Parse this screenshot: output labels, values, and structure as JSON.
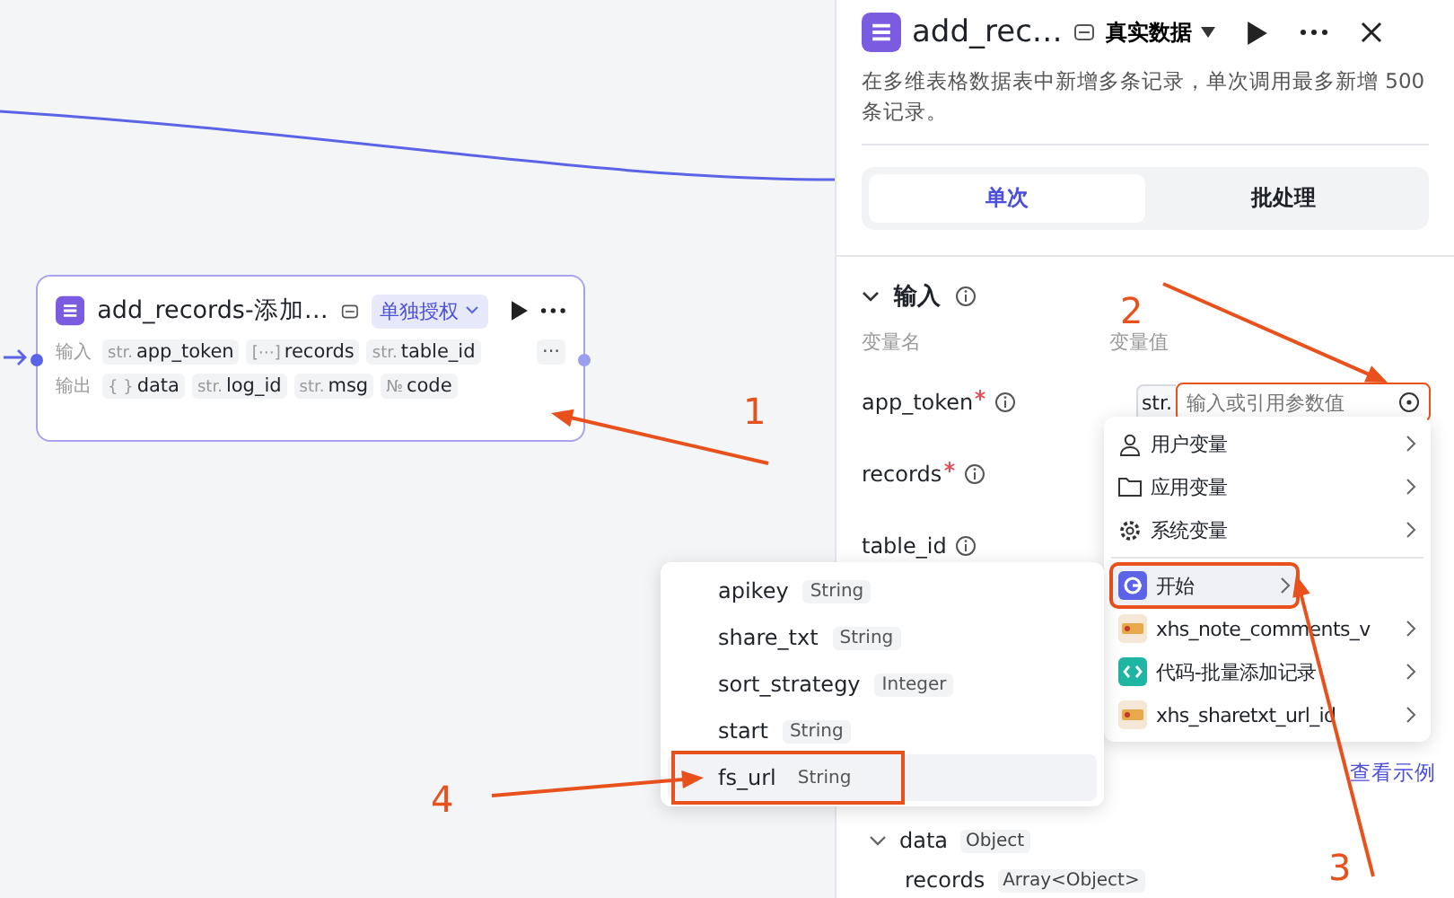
{
  "node": {
    "title": "add_records-添加…",
    "auth": "单独授权",
    "input_label": "输入",
    "inputs": [
      {
        "type": "str.",
        "name": "app_token"
      },
      {
        "type": "[⋯]",
        "name": "records"
      },
      {
        "type": "str.",
        "name": "table_id"
      }
    ],
    "more": "···",
    "output_label": "输出",
    "outputs": [
      {
        "type": "{ }",
        "name": "data"
      },
      {
        "type": "str.",
        "name": "log_id"
      },
      {
        "type": "str.",
        "name": "msg"
      },
      {
        "type": "№",
        "name": "code"
      }
    ]
  },
  "panel": {
    "title": "add_rec…",
    "mode": "真实数据",
    "description": "在多维表格数据表中新增多条记录，单次调用最多新增 500 条记录。",
    "tabs": [
      {
        "label": "单次",
        "selected": true
      },
      {
        "label": "批处理",
        "selected": false
      }
    ],
    "input_section": {
      "title": "输入",
      "expanded": true,
      "name_header": "变量名",
      "value_header": "变量值",
      "params": [
        {
          "name": "app_token",
          "required": true,
          "type": "str.",
          "placeholder": "输入或引用参数值",
          "annotated": true
        },
        {
          "name": "records",
          "required": true
        },
        {
          "name": "table_id",
          "required": false
        }
      ]
    },
    "example_link": "查看示例",
    "output": {
      "name": "data",
      "type": "Object",
      "expanded": true,
      "children": [
        {
          "name": "records",
          "type": "Array<Object>"
        }
      ]
    }
  },
  "reference_menu": [
    {
      "kind": "user",
      "label": "用户变量",
      "selected": false,
      "annotated": false
    },
    {
      "kind": "app",
      "label": "应用变量",
      "selected": false,
      "annotated": false
    },
    {
      "kind": "system",
      "label": "系统变量",
      "selected": false,
      "annotated": false
    },
    {
      "kind": "start",
      "label": "开始",
      "selected": true,
      "annotated": true
    },
    {
      "kind": "plugin",
      "label": "xhs_note_comments_v",
      "selected": false,
      "annotated": false
    },
    {
      "kind": "code",
      "label": "代码-批量添加记录",
      "selected": false,
      "annotated": false
    },
    {
      "kind": "plugin",
      "label": "xhs_sharetxt_url_id",
      "selected": false,
      "annotated": false
    }
  ],
  "start_variables": [
    {
      "name": "apikey",
      "type": "String",
      "selected": false,
      "annotated": false
    },
    {
      "name": "share_txt",
      "type": "String",
      "selected": false,
      "annotated": false
    },
    {
      "name": "sort_strategy",
      "type": "Integer",
      "selected": false,
      "annotated": false
    },
    {
      "name": "start",
      "type": "String",
      "selected": false,
      "annotated": false
    },
    {
      "name": "fs_url",
      "type": "String",
      "selected": true,
      "annotated": true
    }
  ],
  "annotations": [
    "1",
    "2",
    "3",
    "4"
  ]
}
